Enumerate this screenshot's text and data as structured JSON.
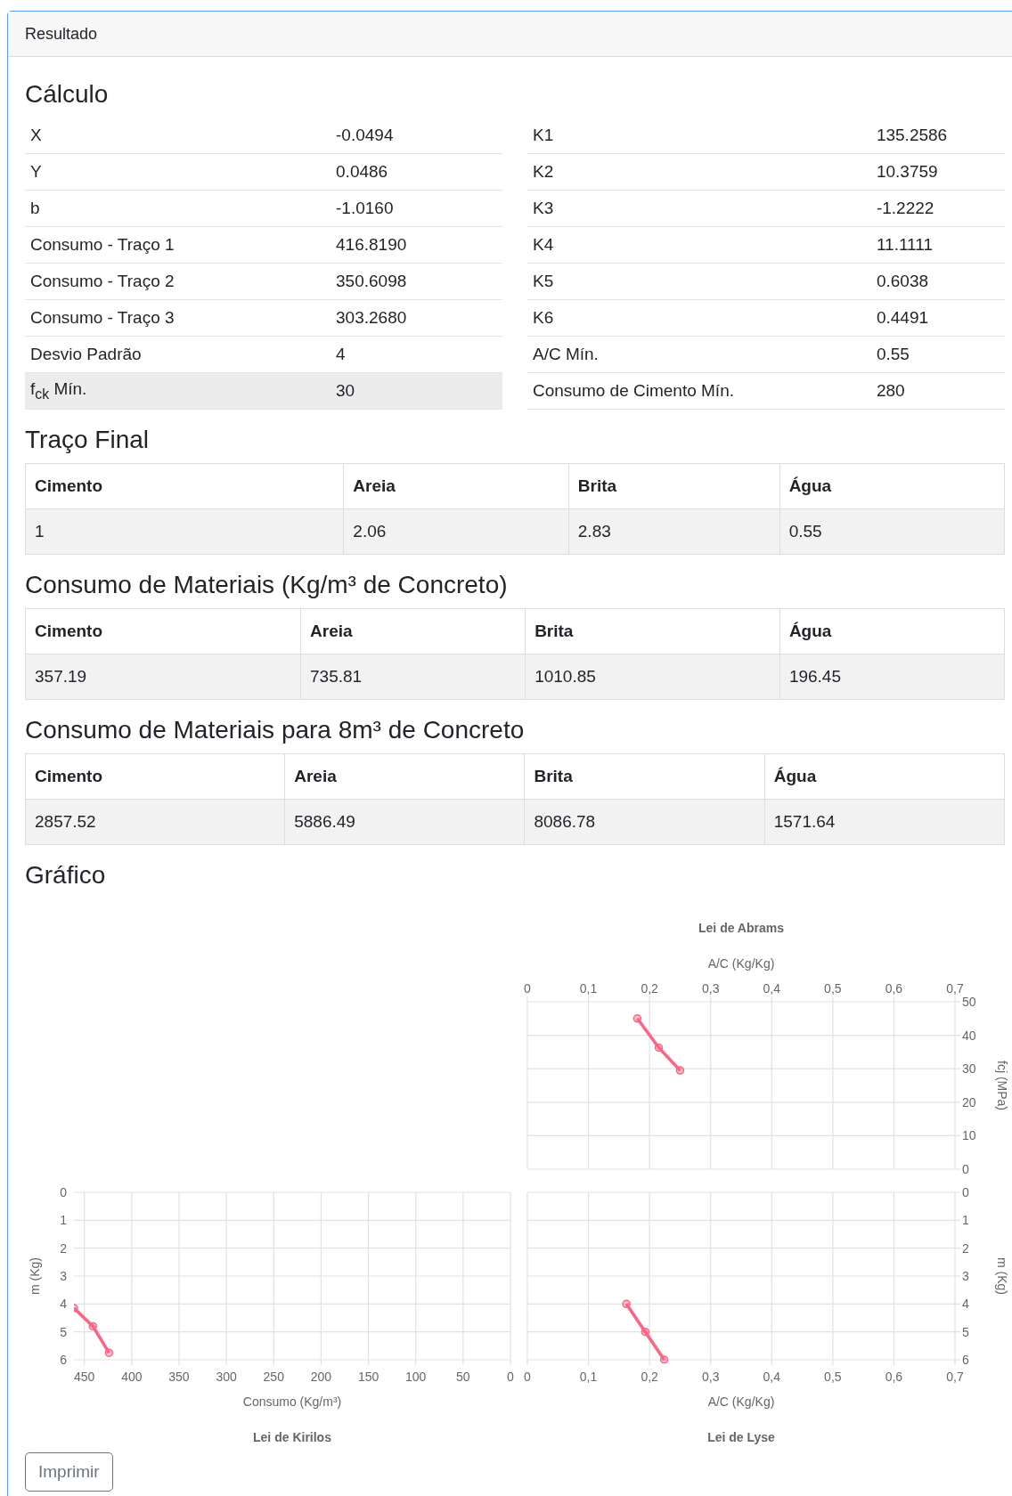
{
  "card": {
    "header": "Resultado"
  },
  "calculo": {
    "title": "Cálculo",
    "left": [
      {
        "label": "X",
        "value": "-0.0494",
        "highlighted": false
      },
      {
        "label": "Y",
        "value": "0.0486",
        "highlighted": false
      },
      {
        "label": "b",
        "value": "-1.0160",
        "highlighted": false
      },
      {
        "label": "Consumo - Traço 1",
        "value": "416.8190",
        "highlighted": false
      },
      {
        "label": "Consumo - Traço 2",
        "value": "350.6098",
        "highlighted": false
      },
      {
        "label": "Consumo - Traço 3",
        "value": "303.2680",
        "highlighted": false
      },
      {
        "label": "Desvio Padrão",
        "value": "4",
        "highlighted": false
      },
      {
        "label": "f$_{ck}$ Mín.",
        "value": "30",
        "highlighted": true
      }
    ],
    "right": [
      {
        "label": "K1",
        "value": "135.2586",
        "highlighted": false
      },
      {
        "label": "K2",
        "value": "10.3759",
        "highlighted": false
      },
      {
        "label": "K3",
        "value": "-1.2222",
        "highlighted": false
      },
      {
        "label": "K4",
        "value": "11.1111",
        "highlighted": false
      },
      {
        "label": "K5",
        "value": "0.6038",
        "highlighted": false
      },
      {
        "label": "K6",
        "value": "0.4491",
        "highlighted": false
      },
      {
        "label": "A/C Mín.",
        "value": "0.55",
        "highlighted": false
      },
      {
        "label": "Consumo de Cimento Mín.",
        "value": "280",
        "highlighted": false
      }
    ]
  },
  "tables": [
    {
      "title": "Traço Final",
      "columns": [
        "Cimento",
        "Areia",
        "Brita",
        "Água"
      ],
      "rows": [
        [
          "1",
          "2.06",
          "2.83",
          "0.55"
        ]
      ]
    },
    {
      "title": "Consumo de Materiais (Kg/m³ de Concreto)",
      "columns": [
        "Cimento",
        "Areia",
        "Brita",
        "Água"
      ],
      "rows": [
        [
          "357.19",
          "735.81",
          "1010.85",
          "196.45"
        ]
      ]
    },
    {
      "title": "Consumo de Materiais para 8m³ de Concreto",
      "columns": [
        "Cimento",
        "Areia",
        "Brita",
        "Água"
      ],
      "rows": [
        [
          "2857.52",
          "5886.49",
          "8086.78",
          "1571.64"
        ]
      ]
    }
  ],
  "grafico": {
    "title": "Gráfico",
    "charts": [
      {
        "top_row": true,
        "x_axis_top": true,
        "y_axis_right": true,
        "chart_data": {
          "type": "line",
          "title": "Lei de Abrams",
          "xlabel": "A/C (Kg/Kg)",
          "ylabel": "fcj (MPa)",
          "grid": true,
          "x": [
            0.18,
            0.215,
            0.25
          ],
          "series": [
            {
              "color": "#ff6384",
              "marker": true,
              "values": [
                45,
                36.3,
                29.5
              ]
            }
          ],
          "xlim": [
            0,
            0.7
          ],
          "ylim": [
            0,
            50
          ],
          "xticks": [
            0,
            {
              "value": 0.1,
              "label": "0,1"
            },
            {
              "value": 0.2,
              "label": "0,2"
            },
            {
              "value": 0.3,
              "label": "0,3"
            },
            {
              "value": 0.4,
              "label": "0,4"
            },
            {
              "value": 0.5,
              "label": "0,5"
            },
            {
              "value": 0.6,
              "label": "0,6"
            },
            {
              "value": 0.7,
              "label": "0,7"
            }
          ],
          "yticks": [
            0,
            10,
            20,
            30,
            40,
            50
          ]
        }
      },
      {
        "top_row": false,
        "x_axis_top": false,
        "y_axis_right": false,
        "chart_data": {
          "type": "line",
          "title": "Lei de Kirilos",
          "xlabel": "Consumo (Kg/m³)",
          "ylabel": "m (Kg)",
          "grid": true,
          "x": [
            461,
            441,
            424
          ],
          "series": [
            {
              "color": "#ff6384",
              "marker": true,
              "values": [
                4.15,
                4.8,
                5.75
              ]
            }
          ],
          "xlim": [
            461,
            0
          ],
          "ylim": [
            6,
            0
          ],
          "xticks": [
            450,
            400,
            350,
            300,
            250,
            200,
            150,
            100,
            50,
            0
          ],
          "yticks": [
            0,
            1,
            2,
            3,
            4,
            5,
            6
          ]
        }
      },
      {
        "top_row": false,
        "x_axis_top": false,
        "y_axis_right": true,
        "chart_data": {
          "type": "line",
          "title": "Lei de Lyse",
          "xlabel": "A/C (Kg/Kg)",
          "ylabel": "m (Kg)",
          "grid": true,
          "x": [
            0.162,
            0.193,
            0.224
          ],
          "series": [
            {
              "color": "#ff6384",
              "marker": true,
              "values": [
                4,
                5,
                6
              ]
            }
          ],
          "xlim": [
            0,
            0.7
          ],
          "ylim": [
            6,
            0
          ],
          "xticks": [
            0,
            {
              "value": 0.1,
              "label": "0,1"
            },
            {
              "value": 0.2,
              "label": "0,2"
            },
            {
              "value": 0.3,
              "label": "0,3"
            },
            {
              "value": 0.4,
              "label": "0,4"
            },
            {
              "value": 0.5,
              "label": "0,5"
            },
            {
              "value": 0.6,
              "label": "0,6"
            },
            {
              "value": 0.7,
              "label": "0,7"
            }
          ],
          "yticks": [
            0,
            1,
            2,
            3,
            4,
            5,
            6
          ]
        }
      }
    ]
  },
  "print_button": {
    "label": "Imprimir"
  }
}
